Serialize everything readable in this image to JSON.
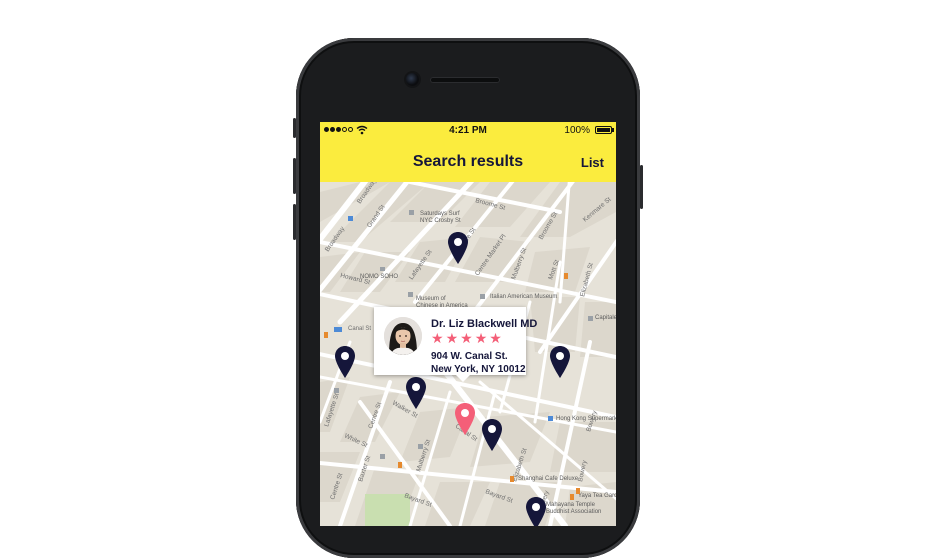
{
  "status_bar": {
    "time": "4:21 PM",
    "battery": "100%"
  },
  "nav": {
    "title": "Search results",
    "list_button": "List"
  },
  "map": {
    "streets": [
      "Broadway",
      "Grand St",
      "Centre St",
      "Broome St",
      "Kenmare St",
      "Howard St",
      "Lafayette St",
      "Mulberry St",
      "Mott St",
      "Elizabeth St",
      "Canal St",
      "Walker St",
      "White St",
      "Bowery",
      "Baxter St",
      "Bayard St"
    ],
    "places": [
      "Saturdays Surf NYC Crosby St",
      "NOMO SOHO",
      "Museum of Chinese in America",
      "Italian American Museum",
      "Capitale",
      "Hong Kong Supermarket",
      "Shanghai Cafe Deluxe",
      "Yaya Tea Garden",
      "Mahayana Temple Buddhist Association",
      "Canal St"
    ],
    "pin_color": "#15163a",
    "selected_pin_color": "#f45f78"
  },
  "card": {
    "name": "Dr. Liz Blackwell MD",
    "rating": 5,
    "star_color": "#f45f78",
    "address_line1": "904 W. Canal St.",
    "address_line2": "New York, NY 10012"
  }
}
